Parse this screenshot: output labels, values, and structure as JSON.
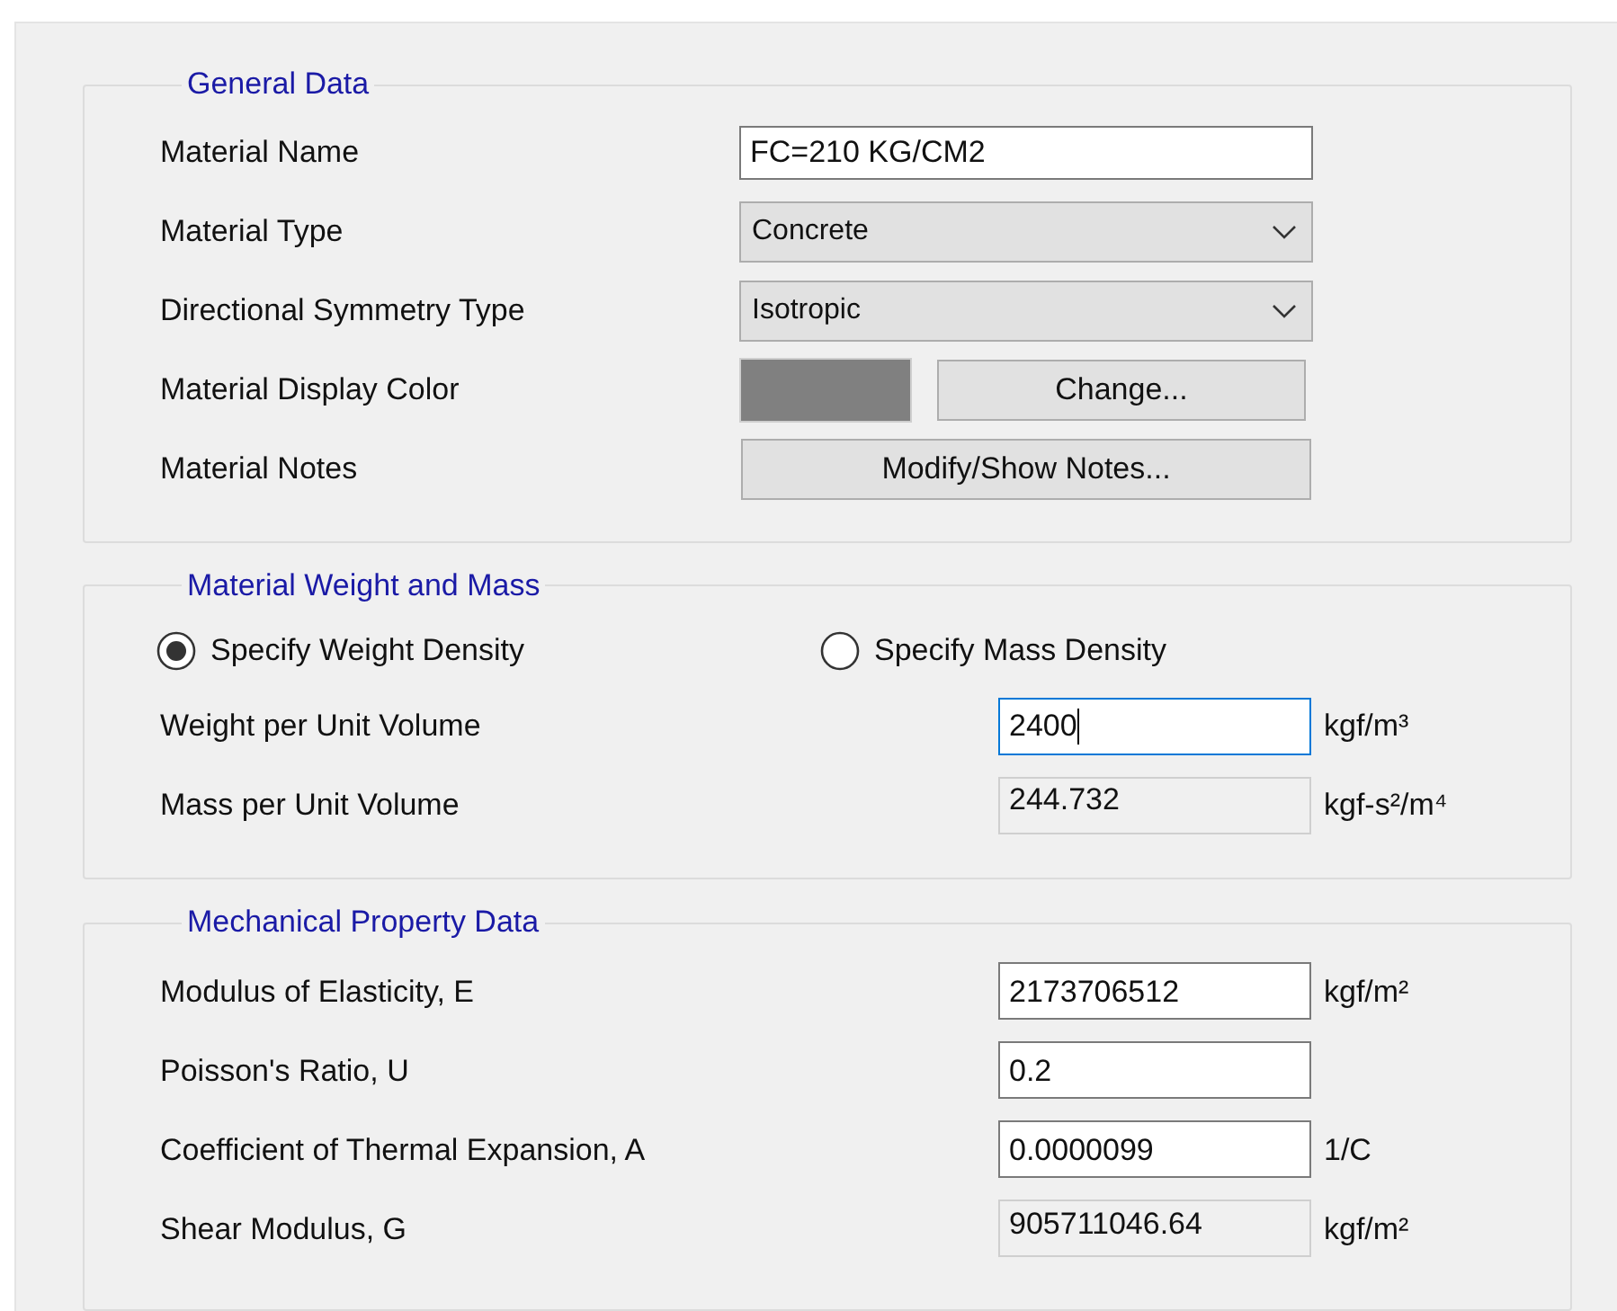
{
  "general_data": {
    "title": "General Data",
    "rows": [
      {
        "kind": "text",
        "label": "Material Name",
        "value": "FC=210 KG/CM2"
      },
      {
        "kind": "dropdown",
        "label": "Material Type",
        "value": "Concrete"
      },
      {
        "kind": "dropdown",
        "label": "Directional Symmetry Type",
        "value": "Isotropic"
      },
      {
        "kind": "color",
        "label": "Material Display Color",
        "color": "#808080",
        "button": "Change..."
      },
      {
        "kind": "button",
        "label": "Material Notes",
        "button": "Modify/Show Notes..."
      }
    ]
  },
  "weight_and_mass": {
    "title": "Material Weight and Mass",
    "options": [
      {
        "label": "Specify Weight Density",
        "selected": true
      },
      {
        "label": "Specify Mass Density",
        "selected": false
      }
    ],
    "rows": [
      {
        "label": "Weight per Unit Volume",
        "value": "2400",
        "unit": "kgf/m³",
        "editable": true,
        "focused": true
      },
      {
        "label": "Mass per Unit Volume",
        "value": "244.732",
        "unit": "kgf-s²/m⁴",
        "editable": false,
        "focused": false
      }
    ]
  },
  "mechanical_property_data": {
    "title": "Mechanical Property Data",
    "rows": [
      {
        "label": "Modulus of Elasticity,  E",
        "value": "2173706512",
        "unit": "kgf/m²",
        "editable": true,
        "focused": false
      },
      {
        "label": "Poisson's Ratio,  U",
        "value": "0.2",
        "editable": true,
        "focused": false
      },
      {
        "label": "Coefficient of Thermal Expansion,  A",
        "value": "0.0000099",
        "unit": "1/C",
        "editable": true,
        "focused": false
      },
      {
        "label": "Shear Modulus,  G",
        "value": "905711046.64",
        "unit": "kgf/m²",
        "editable": false,
        "focused": false
      }
    ]
  }
}
